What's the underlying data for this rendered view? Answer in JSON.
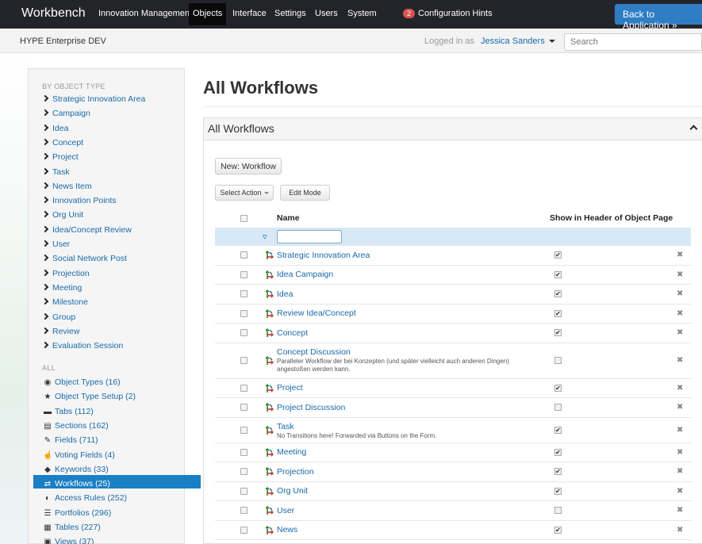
{
  "topnav": {
    "brand": "Workbench",
    "items": [
      "Innovation Management",
      "Objects",
      "Interface",
      "Settings",
      "Users",
      "System"
    ],
    "active": "Objects",
    "hints_count": "2",
    "hints_label": "Configuration Hints",
    "back_label": "Back to Application »"
  },
  "subbar": {
    "environment": "HYPE Enterprise DEV",
    "logged_in_label": "Logged in as",
    "user_name": "Jessica Sanders",
    "search_placeholder": "Search"
  },
  "sidebar": {
    "by_type_heading": "BY OBJECT TYPE",
    "type_items": [
      "Strategic Innovation Area",
      "Campaign",
      "Idea",
      "Concept",
      "Project",
      "Task",
      "News Item",
      "Innovation Points",
      "Org Unit",
      "Idea/Concept Review",
      "User",
      "Social Network Post",
      "Projection",
      "Meeting",
      "Milestone",
      "Group",
      "Review",
      "Evaluation Session"
    ],
    "all_heading": "ALL",
    "all_items": [
      {
        "label": "Object Types (16)",
        "icon": "cube-icon"
      },
      {
        "label": "Object Type Setup (2)",
        "icon": "star-icon"
      },
      {
        "label": "Tabs (112)",
        "icon": "folder-icon"
      },
      {
        "label": "Sections (162)",
        "icon": "sections-icon"
      },
      {
        "label": "Fields (711)",
        "icon": "edit-icon"
      },
      {
        "label": "Voting Fields (4)",
        "icon": "thumbs-up-icon"
      },
      {
        "label": "Keywords (33)",
        "icon": "tag-icon"
      },
      {
        "label": "Workflows (25)",
        "icon": "workflow-icon"
      },
      {
        "label": "Access Rules (252)",
        "icon": "access-icon"
      },
      {
        "label": "Portfolios (296)",
        "icon": "list-icon"
      },
      {
        "label": "Tables (227)",
        "icon": "table-icon"
      },
      {
        "label": "Views (37)",
        "icon": "views-icon"
      }
    ],
    "active_item": "Workflows (25)"
  },
  "main": {
    "page_title": "All Workflows",
    "panel_title": "All Workflows",
    "new_button": "New: Workflow",
    "select_action": "Select Action",
    "edit_mode": "Edit Mode",
    "col_name": "Name",
    "col_show": "Show in Header of Object Page",
    "rows": [
      {
        "name": "Strategic Innovation Area",
        "desc": "",
        "show": true
      },
      {
        "name": "Idea Campaign",
        "desc": "",
        "show": true
      },
      {
        "name": "Idea",
        "desc": "",
        "show": true
      },
      {
        "name": "Review Idea/Concept",
        "desc": "",
        "show": true
      },
      {
        "name": "Concept",
        "desc": "",
        "show": true
      },
      {
        "name": "Concept Discussion",
        "desc": "Paralleler Workflow der bei Konzepten (und später vielleicht auch anderen Dingen) angestoßen werden kann.",
        "show": false
      },
      {
        "name": "Project",
        "desc": "",
        "show": true
      },
      {
        "name": "Project Discussion",
        "desc": "",
        "show": false
      },
      {
        "name": "Task",
        "desc": "No Transitions here! Forwarded via Buttons on the Form.",
        "show": true
      },
      {
        "name": "Meeting",
        "desc": "",
        "show": true
      },
      {
        "name": "Projection",
        "desc": "",
        "show": true
      },
      {
        "name": "Org Unit",
        "desc": "",
        "show": true
      },
      {
        "name": "User",
        "desc": "",
        "show": false
      },
      {
        "name": "News",
        "desc": "",
        "show": true
      }
    ]
  },
  "colors": {
    "navbar": "#23242a",
    "accent": "#1a7fc4",
    "link": "#1a6aa8",
    "filter_row": "#d7e9f5"
  }
}
